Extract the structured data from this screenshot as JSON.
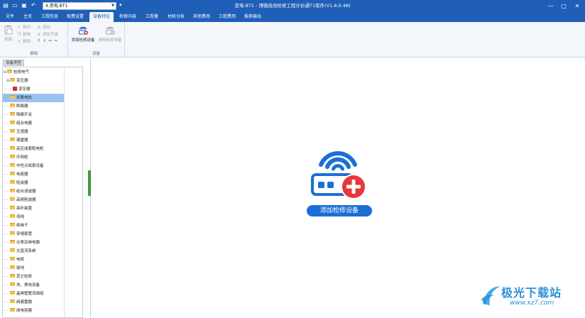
{
  "titlebar": {
    "project_value": "4.变电.BT1",
    "window_title": "变电.BT1 - 博微技改检修工程计价通T1软件(V1.6.0.48)",
    "minimize": "—",
    "maximize": "□",
    "close": "✕"
  },
  "menu": {
    "tabs": [
      {
        "label": "文件"
      },
      {
        "label": "主页"
      },
      {
        "label": "工程信息"
      },
      {
        "label": "取费设置"
      },
      {
        "label": "设备特征"
      },
      {
        "label": "检修内容"
      },
      {
        "label": "工程量"
      },
      {
        "label": "材机分析"
      },
      {
        "label": "其他费用"
      },
      {
        "label": "工程费用"
      },
      {
        "label": "报表输出"
      }
    ],
    "active_tab": "设备特征"
  },
  "ribbon": {
    "edit": {
      "group_label": "编辑",
      "paste": "粘贴",
      "cut": "剪切",
      "copy": "复制",
      "delete": "删除",
      "add": "添加",
      "add_child": "添加子级"
    },
    "device": {
      "group_label": "设备",
      "add_device": "添加检修设备",
      "clear_device": "清除检修设备"
    }
  },
  "left_panel": {
    "tab_label": "设备类型",
    "tree": [
      {
        "label": "检修电气"
      },
      {
        "label": "变压器"
      },
      {
        "label": "变压器"
      },
      {
        "label": "并联电抗"
      },
      {
        "label": "断路器"
      },
      {
        "label": "隔离开关"
      },
      {
        "label": "组合电器"
      },
      {
        "label": "互感器"
      },
      {
        "label": "避雷器"
      },
      {
        "label": "高压成套配电柜"
      },
      {
        "label": "环网柜"
      },
      {
        "label": "中性点成套设备"
      },
      {
        "label": "电容器"
      },
      {
        "label": "阻波器"
      },
      {
        "label": "结合滤波器"
      },
      {
        "label": "高频阻波器"
      },
      {
        "label": "串补装置"
      },
      {
        "label": "母线"
      },
      {
        "label": "绝缘子"
      },
      {
        "label": "穿墙套管"
      },
      {
        "label": "仪表及继电器"
      },
      {
        "label": "交直流系统"
      },
      {
        "label": "电缆"
      },
      {
        "label": "接地"
      },
      {
        "label": "其它检修"
      },
      {
        "label": "充、换电设备"
      },
      {
        "label": "晶闸管整流阀组"
      },
      {
        "label": "阀避雷器"
      },
      {
        "label": "阀电容器"
      }
    ]
  },
  "main": {
    "add_button_label": "添加检修设备"
  },
  "watermark": {
    "name": "极光下载站",
    "url": "www.xz7.com"
  },
  "colors": {
    "title_blue": "#1f5fb8",
    "accent_blue": "#1a6fd6",
    "plus_red": "#e8363b",
    "selection": "#9ec2f0",
    "splitter_green": "#3a9a3a"
  }
}
